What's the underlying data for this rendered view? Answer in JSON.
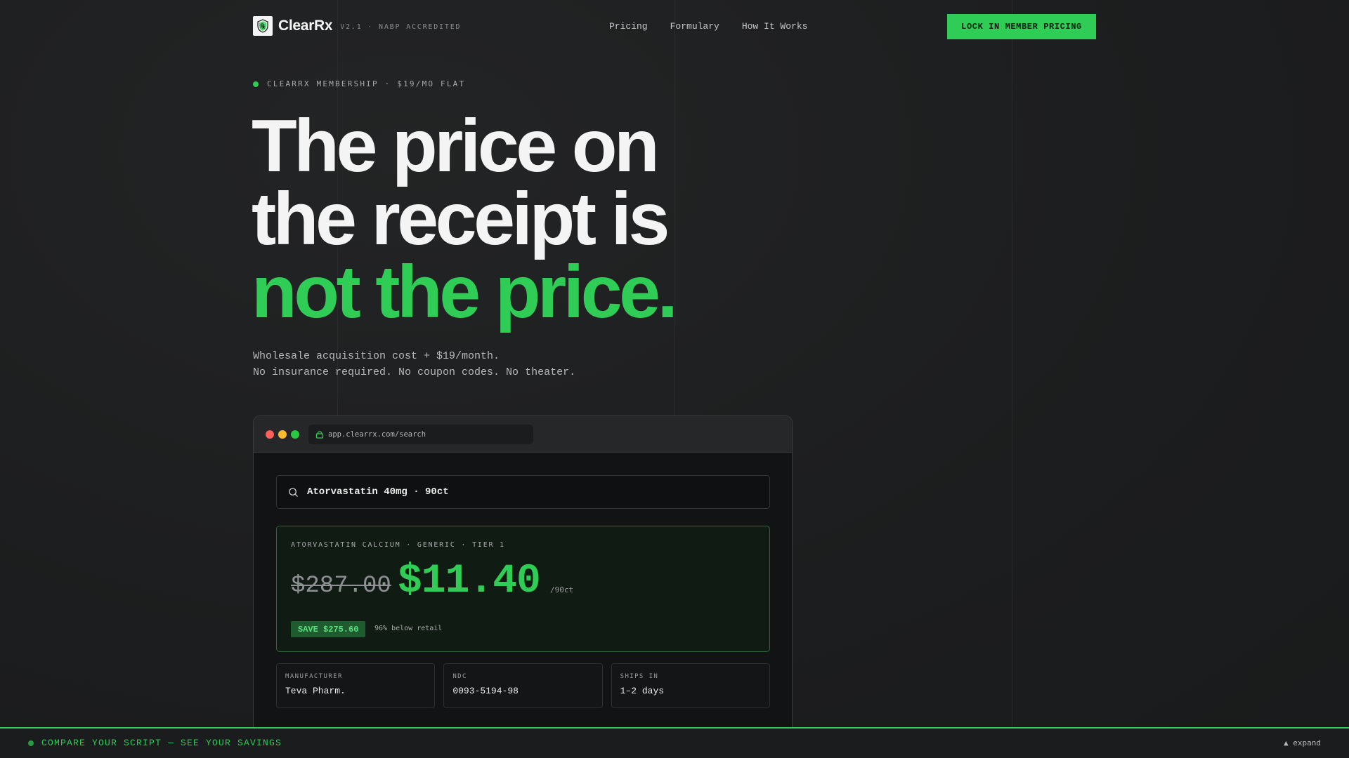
{
  "brand": {
    "name": "ClearRx",
    "meta": "V2.1 · NABP ACCREDITED",
    "logo_icon": "shield-rx-icon"
  },
  "nav": {
    "links": [
      "Pricing",
      "Formulary",
      "How It Works"
    ],
    "cta_label": "LOCK IN MEMBER PRICING"
  },
  "hero": {
    "eyebrow": "CLEARRX MEMBERSHIP · $19/MO FLAT",
    "headline_line1": "The price on",
    "headline_line2": "the receipt is",
    "headline_line3": "not the price.",
    "sub_line1": "Wholesale acquisition cost + $19/month.",
    "sub_line2": "No insurance required. No coupon codes. No theater."
  },
  "browser": {
    "url": "app.clearrx.com/search",
    "search_value": "Atorvastatin 40mg · 90ct",
    "result": {
      "label": "ATORVASTATIN CALCIUM · GENERIC · TIER 1",
      "old_price": "$287.00",
      "new_price": "$11.40",
      "per": "/90ct",
      "save_badge": "SAVE $275.60",
      "save_note": "96% below retail"
    },
    "specs": [
      {
        "label": "MANUFACTURER",
        "value": "Teva Pharm."
      },
      {
        "label": "NDC",
        "value": "0093-5194-98"
      },
      {
        "label": "SHIPS IN",
        "value": "1–2 days"
      }
    ]
  },
  "bottom_bar": {
    "text": "COMPARE YOUR SCRIPT — SEE YOUR SAVINGS",
    "toggle": "▲ expand"
  },
  "colors": {
    "accent": "#2fcd55",
    "background": "#1d1e1f",
    "traffic_red": "#ff5f57",
    "traffic_yellow": "#febc2e",
    "traffic_green": "#28c840"
  }
}
